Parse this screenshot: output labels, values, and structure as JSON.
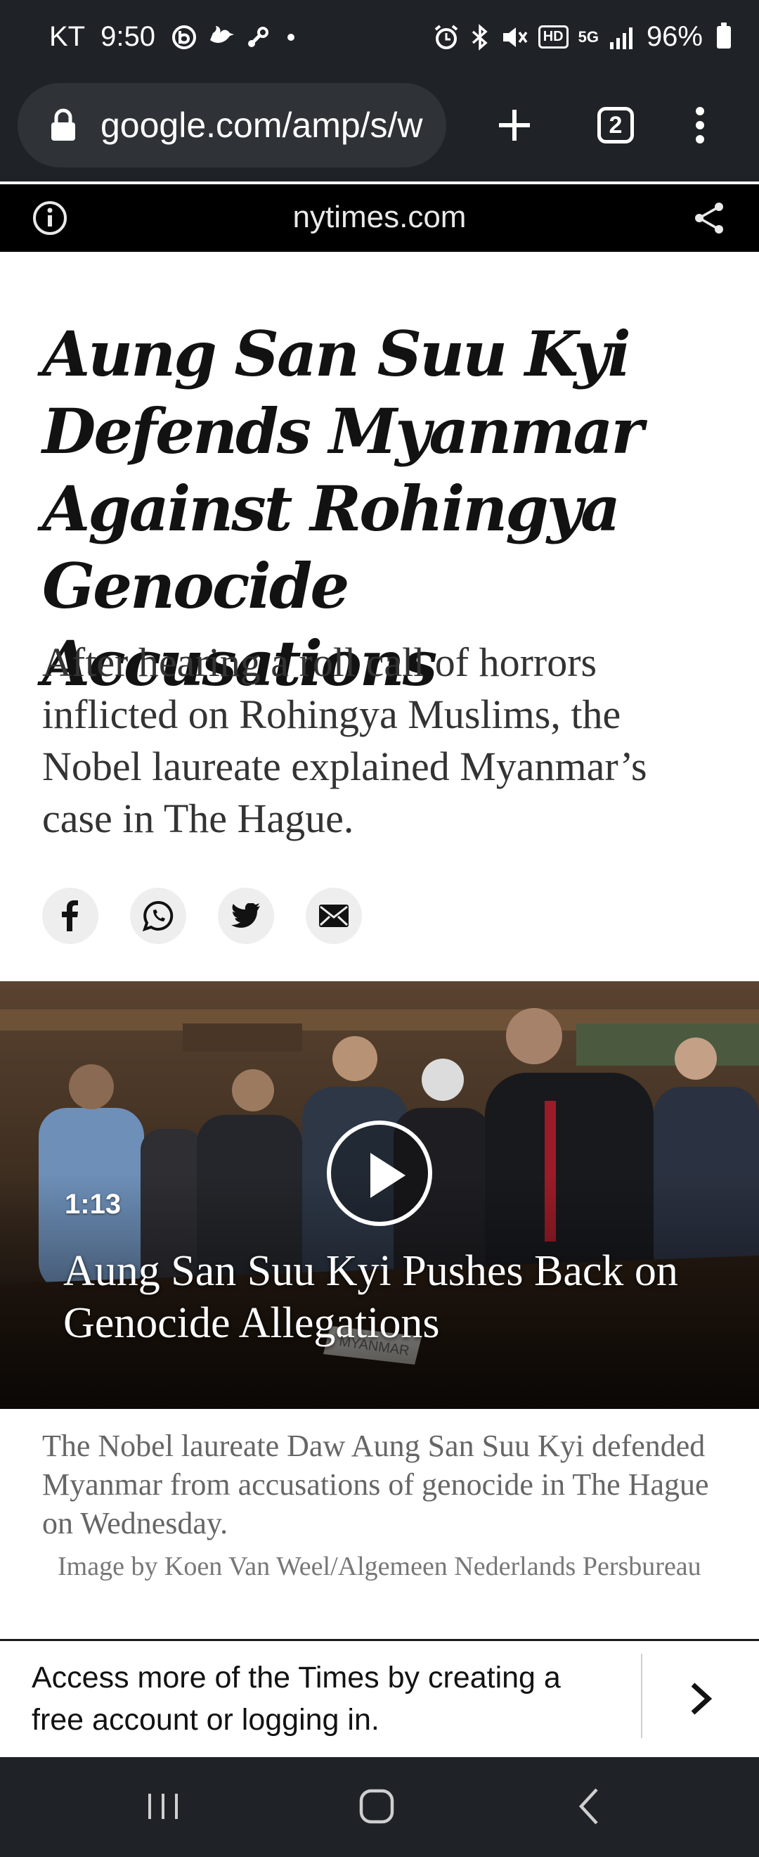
{
  "status_bar": {
    "carrier": "KT",
    "time": "9:50",
    "network_badge_hd": "HD",
    "network_badge_5g": "5G",
    "battery_percent": "96%"
  },
  "browser": {
    "url": "google.com/amp/s/w",
    "tab_count": "2"
  },
  "amp_header": {
    "domain": "nytimes.com"
  },
  "article": {
    "headline": "Aung San Suu Kyi Defends Myanmar Against Rohingya Genocide Accusations",
    "summary": "After hearing a roll call of horrors inflicted on Rohingya Muslims, the Nobel laureate explained Myanmar’s case in The Hague.",
    "share_buttons": [
      "facebook-icon",
      "whatsapp-icon",
      "twitter-icon",
      "email-icon"
    ]
  },
  "video": {
    "duration": "1:13",
    "title": "Aung San Suu Kyi Pushes Back on Genocide Allegations",
    "placard_text": "MYANMAR"
  },
  "caption": {
    "text": "The Nobel laureate Daw Aung San Suu Kyi defended Myanmar from accusations of genocide in The Hague on Wednesday.",
    "credit": "Image by Koen Van Weel/Algemeen Nederlands Persbureau"
  },
  "banner": {
    "text": "Access more of the Times by creating a free account or logging in."
  },
  "colors": {
    "system_bar": "#1f2226",
    "amp_bar": "#000000",
    "headline": "#121212"
  }
}
